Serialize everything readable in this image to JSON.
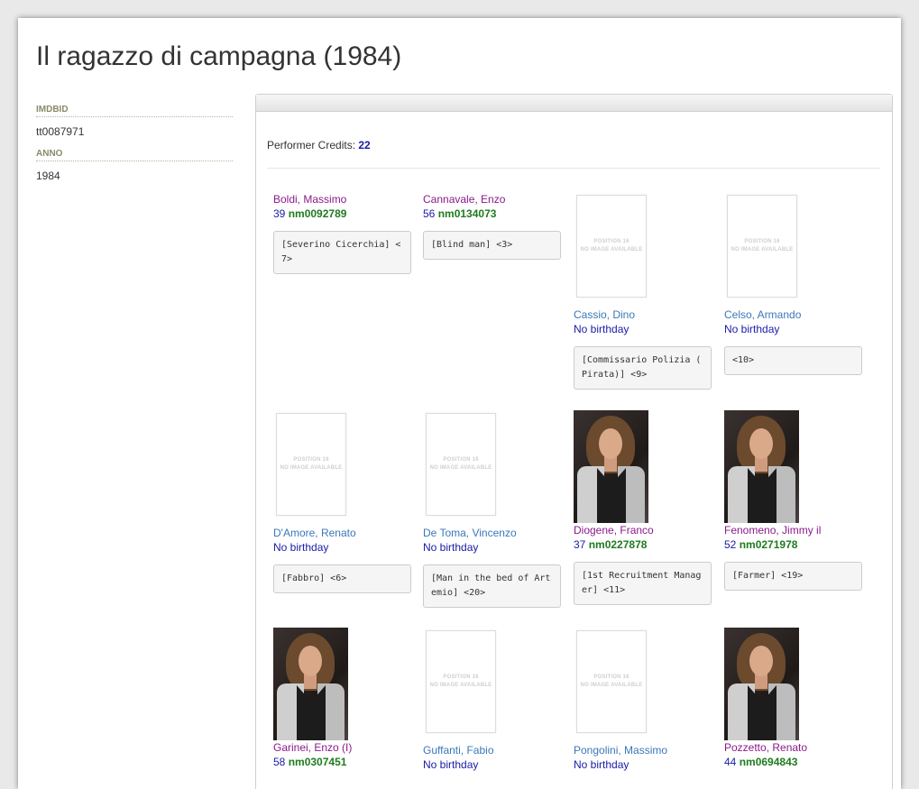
{
  "title": "Il ragazzo di campagna (1984)",
  "sidebar": {
    "imdbid_label": "IMDBID",
    "imdbid_value": "tt0087971",
    "anno_label": "ANNO",
    "anno_value": "1984"
  },
  "credits": {
    "label": "Performer Credits:",
    "count": "22"
  },
  "placeholder": {
    "line1": "POSITION 16",
    "line2": "NO IMAGE AVAILABLE"
  },
  "performers": [
    {
      "name": "Boldi, Massimo",
      "age": "39",
      "nm": "nm0092789",
      "role": "[Severino Cicerchia]  <7>"
    },
    {
      "name": "Cannavale, Enzo",
      "age": "56",
      "nm": "nm0134073",
      "role": "[Blind man]  <3>"
    },
    {
      "name": "Cassio, Dino",
      "birthday": "No birthday",
      "role": "[Commissario Polizia ( Pirata)]  <9>"
    },
    {
      "name": "Celso, Armando",
      "birthday": "No birthday",
      "role": "<10>"
    },
    {
      "name": "D'Amore, Renato",
      "birthday": "No birthday",
      "role": "[Fabbro]  <6>"
    },
    {
      "name": "De Toma, Vincenzo",
      "birthday": "No birthday",
      "role": "[Man in the bed of Artemio]  <20>"
    },
    {
      "name": "Diogene, Franco",
      "age": "37",
      "nm": "nm0227878",
      "role": "[1st Recruitment Manager]  <11>"
    },
    {
      "name": "Fenomeno, Jimmy il",
      "age": "52",
      "nm": "nm0271978",
      "role": "[Farmer]  <19>"
    },
    {
      "name": "Garinei, Enzo (I)",
      "age": "58",
      "nm": "nm0307451"
    },
    {
      "name": "Guffanti, Fabio",
      "birthday": "No birthday"
    },
    {
      "name": "Pongolini, Massimo",
      "birthday": "No birthday"
    },
    {
      "name": "Pozzetto, Renato",
      "age": "44",
      "nm": "nm0694843"
    }
  ]
}
